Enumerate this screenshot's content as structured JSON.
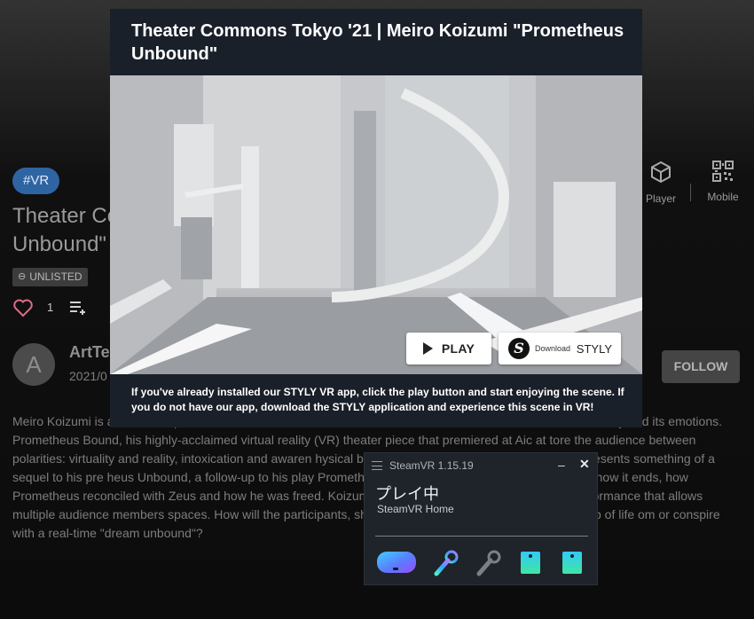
{
  "page": {
    "tag": "#VR",
    "title": "Theater Commons Tokyo '21 | Meiro Koizumi \"Prometheus Unbound\"",
    "title_visible": "Theater Co\nUnbound\"",
    "unlisted": "UNLISTED",
    "like_count": "1",
    "avatar_letter": "A",
    "author": "ArtTe",
    "date": "2021/0",
    "player_label": "Player",
    "mobile_label": "Mobile",
    "follow_label": "FOLLOW",
    "description": "Meiro Koizumi is a                                                                                                relationships between the state, the collective, and the individual, as well as the human body and its emotions. Prometheus Bound, his highly-acclaimed virtual reality (VR) theater piece that premiered at Aic                                                                                           at tore the audience between polarities: virtuality and reality, intoxication and awaren                                                                                                   hysical bodies. With this new VR piece, Koizumi presents something of a sequel to his pre                                                                                                   heus Unbound, a follow-up to his play Prometheus Bound written about 2,500 yea                                                                                                   owing how it ends, how Prometheus reconciled with Zeus and how he was freed. Koizum                                                                                                   ra and reconstructs it as a ritualistic performance that allows multiple audience members                                                                                                   spaces. How will the participants, sharing a ceremonial experience on the cusp of life                                                                                                   om or conspire with a real-time \"dream unbound\"?"
  },
  "modal": {
    "title": "Theater Commons Tokyo '21 | Meiro Koizumi \"Prometheus Unbound\"",
    "play_label": "PLAY",
    "download_small": "Download",
    "download_brand": "STYLY",
    "note": "If you've already installed our STYLY VR app, click the play button and start enjoying the scene. If you do not have our app, download the STYLY application and experience this scene in VR!"
  },
  "steamvr": {
    "title": "SteamVR 1.15.19",
    "status": "プレイ中",
    "subtitle": "SteamVR Home",
    "minimize": "‒",
    "close": "✕",
    "devices": [
      "headset-icon",
      "controller-left-icon",
      "controller-right-icon",
      "tracker-1-icon",
      "tracker-2-icon"
    ]
  },
  "colors": {
    "tag_bg": "#2f64a3",
    "modal_bg": "#1a2029",
    "steamvr_bg": "#1f232a",
    "heart": "#e06b86"
  }
}
